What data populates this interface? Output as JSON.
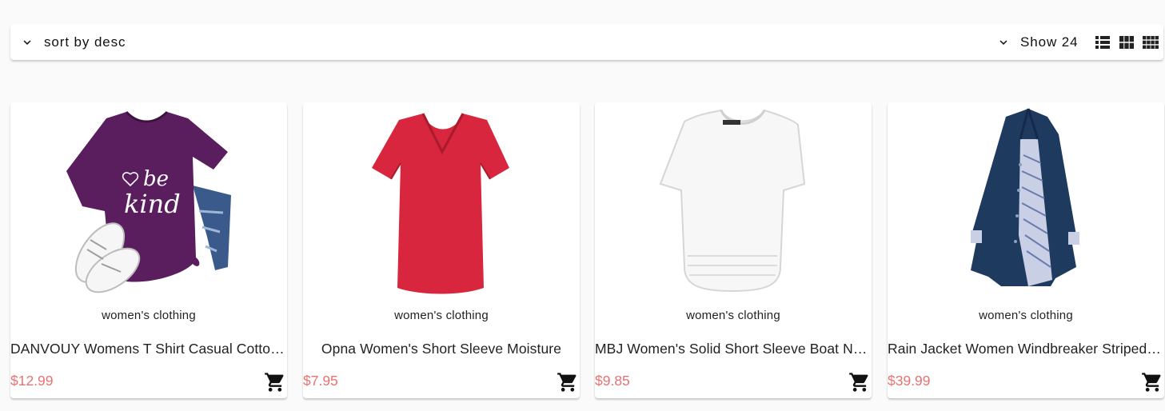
{
  "toolbar": {
    "sort_label": "sort by desc",
    "show_label": "Show 24",
    "sort_icon": "chevron-down-icon",
    "show_icon": "chevron-down-icon",
    "view_icons": [
      "view-list-icon",
      "view-module-icon",
      "view-comfy-icon"
    ]
  },
  "colors": {
    "price": "#e57373",
    "background": "#fafafa",
    "card": "#ffffff"
  },
  "products": [
    {
      "category": "women's clothing",
      "title": "DANVOUY Womens T Shirt Casual Cotton Short",
      "price": "$12.99",
      "image": "purple-be-kind-tshirt",
      "cart_icon": "cart-icon"
    },
    {
      "category": "women's clothing",
      "title": "Opna Women's Short Sleeve Moisture",
      "price": "$7.95",
      "image": "red-vneck-tshirt",
      "cart_icon": "cart-icon"
    },
    {
      "category": "women's clothing",
      "title": "MBJ Women's Solid Short Sleeve Boat Neck V",
      "price": "$9.85",
      "image": "white-boat-neck-top",
      "cart_icon": "cart-icon"
    },
    {
      "category": "women's clothing",
      "title": "Rain Jacket Women Windbreaker Striped Climbing Raincoats",
      "price": "$39.99",
      "image": "navy-rain-jacket",
      "cart_icon": "cart-icon"
    }
  ]
}
